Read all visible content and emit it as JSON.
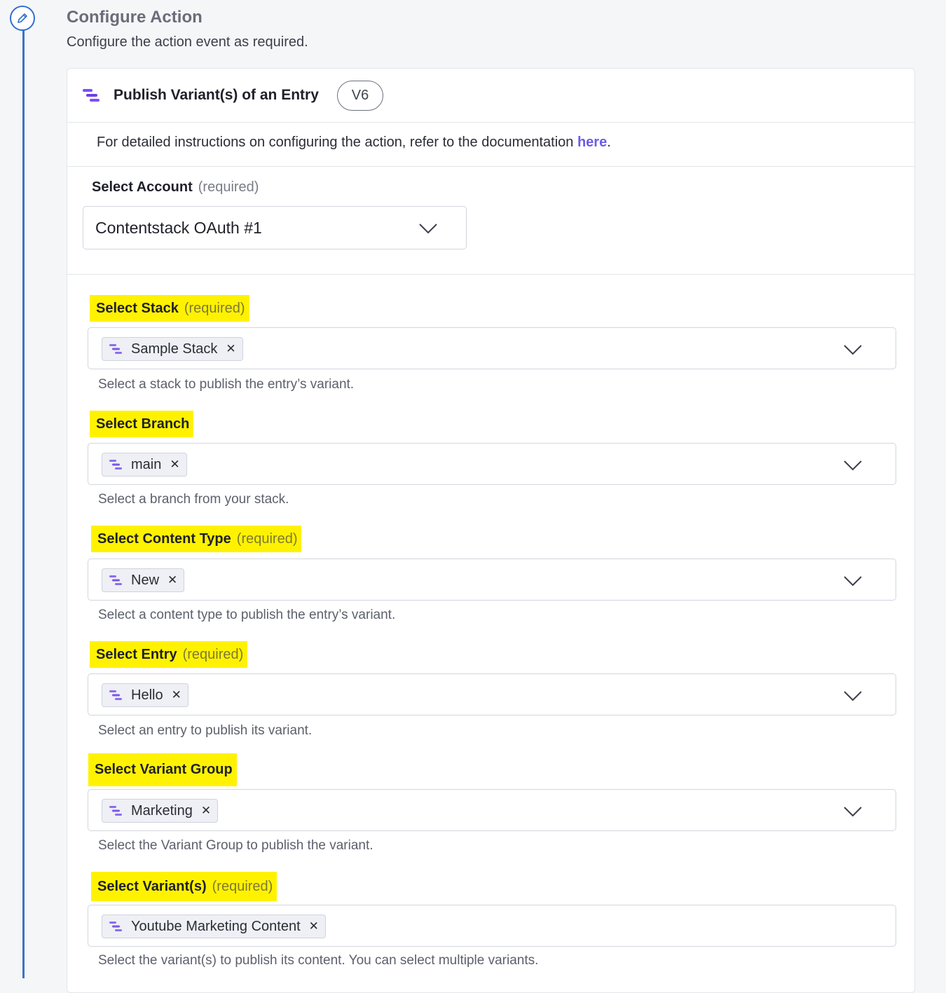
{
  "step": {
    "icon": "pencil-icon",
    "title": "Configure Action",
    "subtitle": "Configure the action event as required."
  },
  "card": {
    "icon": "contentstack-logo-icon",
    "title": "Publish Variant(s) of an Entry",
    "version": "V6",
    "info_text": "For detailed instructions on configuring the action, refer to the documentation ",
    "info_link": "here",
    "info_end": "."
  },
  "account": {
    "label": "Select Account",
    "required": "(required)",
    "value": "Contentstack OAuth #1"
  },
  "fields": [
    {
      "label": "Select Stack",
      "required": "(required)",
      "chip": "Sample Stack",
      "help": "Select a stack to publish the entry’s variant."
    },
    {
      "label": "Select Branch",
      "required": "",
      "chip": "main",
      "help": "Select a branch from your stack."
    },
    {
      "label": "Select Content Type",
      "required": "(required)",
      "chip": "New",
      "help": "Select a content type to publish the entry’s variant."
    },
    {
      "label": "Select Entry",
      "required": "(required)",
      "chip": "Hello",
      "help": "Select an entry to publish its variant."
    },
    {
      "label": "Select Variant Group",
      "required": "",
      "chip": "Marketing",
      "help": "Select the Variant Group to publish the variant."
    },
    {
      "label": "Select Variant(s)",
      "required": "(required)",
      "chip": "Youtube Marketing Content",
      "help": "Select the variant(s) to publish its content. You can select multiple variants."
    }
  ],
  "colors": {
    "highlight": "#fff200",
    "accent": "#6c5ce7",
    "rail": "#3d73c9"
  }
}
